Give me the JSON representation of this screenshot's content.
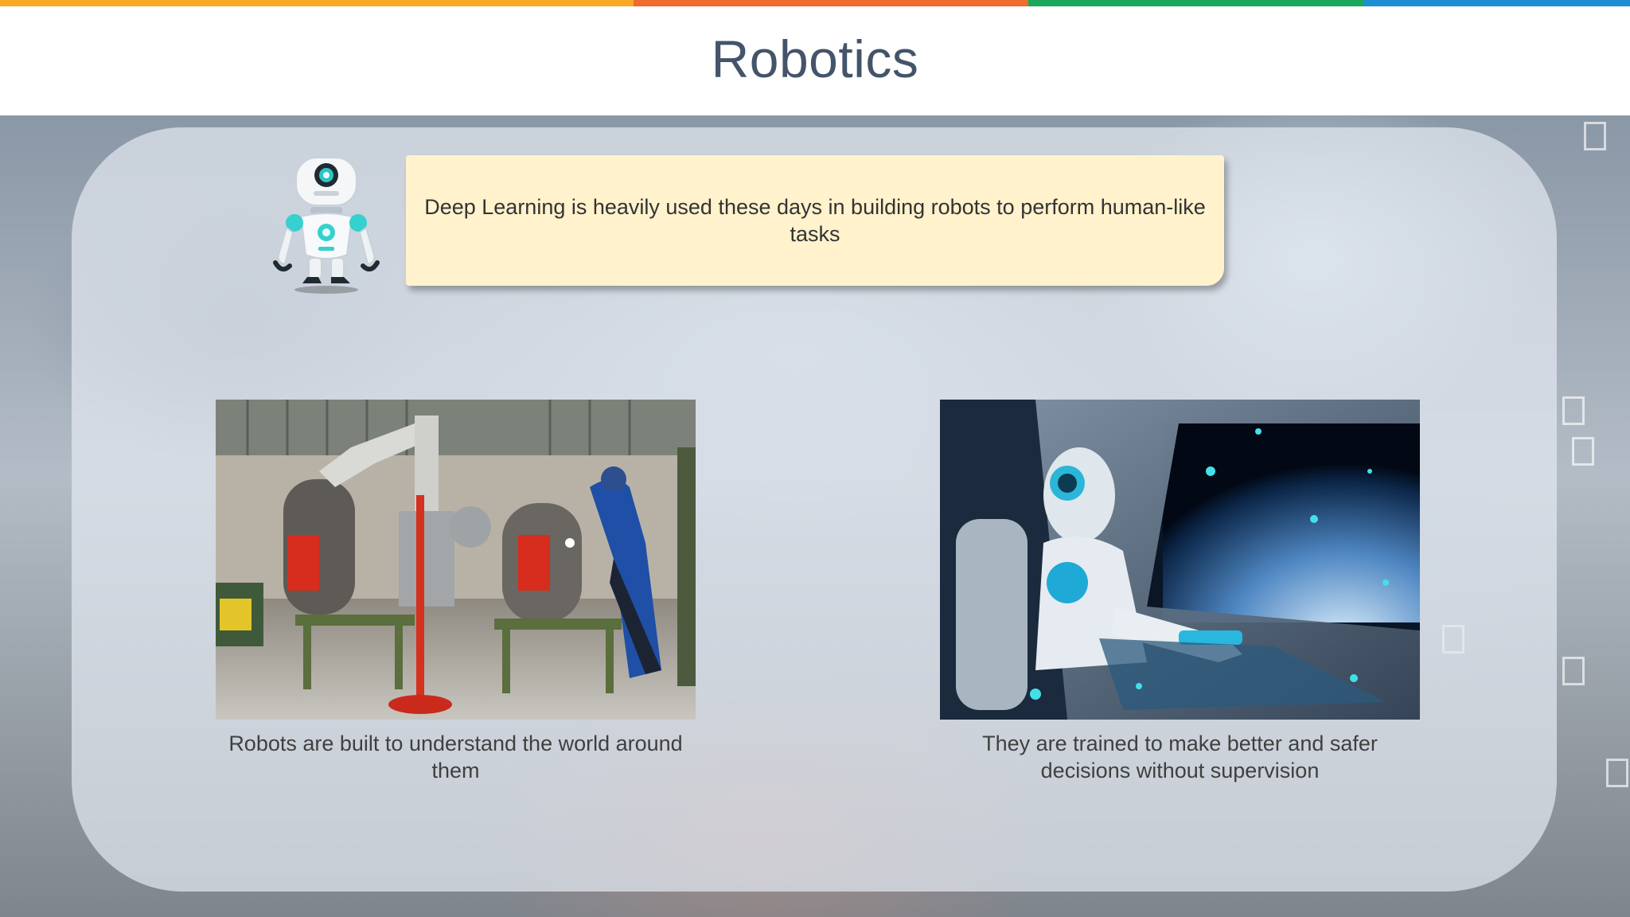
{
  "slide": {
    "title": "Robotics",
    "callout": "Deep Learning is heavily used these days in building robots to perform human-like tasks",
    "images": [
      {
        "name": "robotic-welding-photo",
        "caption": "Robots are built to understand the world around them"
      },
      {
        "name": "humanoid-robot-spacecraft-photo",
        "caption": "They are trained to make better and safer decisions without supervision"
      }
    ]
  },
  "colors": {
    "accent_bar": [
      "#f9a825",
      "#ef6c2a",
      "#1aa75c",
      "#1e8fd6"
    ],
    "title": "#44546a",
    "callout_fill": "#fff2cc"
  },
  "icons": [
    "robot-mascot-icon"
  ]
}
